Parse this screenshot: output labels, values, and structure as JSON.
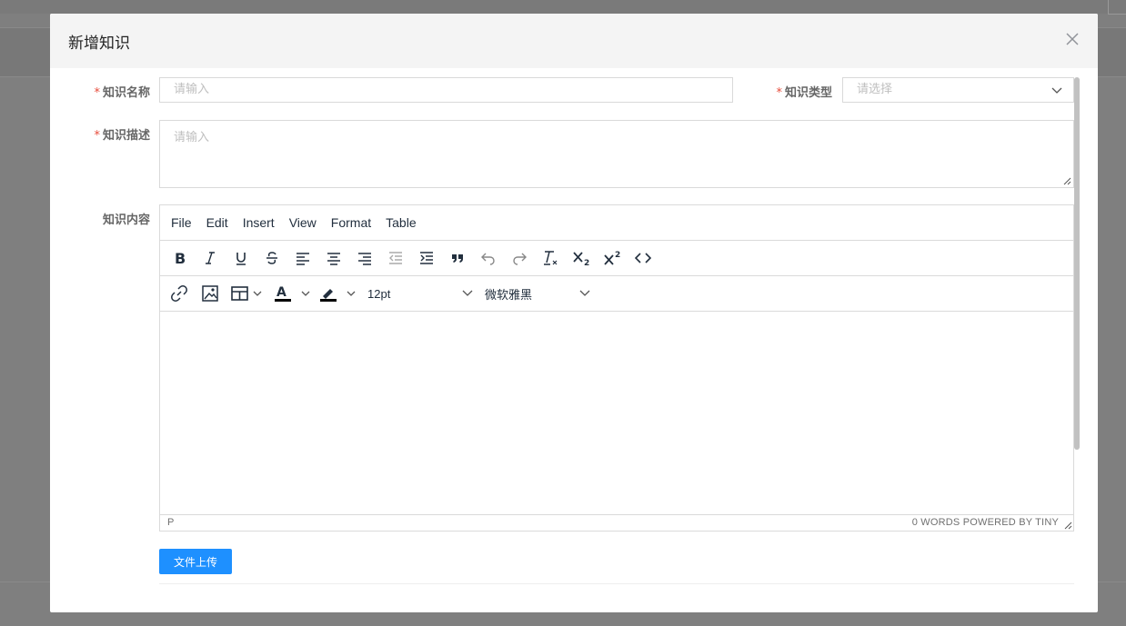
{
  "dialog": {
    "title": "新增知识"
  },
  "form": {
    "name": {
      "required_mark": "*",
      "label": "知识名称",
      "placeholder": "请输入"
    },
    "type": {
      "required_mark": "*",
      "label": "知识类型",
      "placeholder": "请选择"
    },
    "description": {
      "required_mark": "*",
      "label": "知识描述",
      "placeholder": "请输入"
    },
    "content": {
      "label": "知识内容"
    }
  },
  "editor": {
    "menus": [
      "File",
      "Edit",
      "Insert",
      "View",
      "Format",
      "Table"
    ],
    "font_size": "12pt",
    "font_family": "微软雅黑",
    "status_path": "P",
    "status_words": "0 WORDS  POWERED BY TINY"
  },
  "upload_button": "文件上传",
  "colors": {
    "primary": "#1e90ff",
    "required": "#e74c3c",
    "overlay": "#7f7f7f"
  },
  "icons": {
    "toolbar1": [
      "bold-icon",
      "italic-icon",
      "underline-icon",
      "strikethrough-icon",
      "align-left-icon",
      "align-center-icon",
      "align-right-icon",
      "outdent-icon",
      "indent-icon",
      "blockquote-icon",
      "undo-icon",
      "redo-icon",
      "remove-format-icon",
      "subscript-icon",
      "superscript-icon",
      "code-icon"
    ],
    "toolbar2": [
      "link-icon",
      "image-icon",
      "table-icon",
      "text-color-icon",
      "highlight-color-icon"
    ]
  }
}
